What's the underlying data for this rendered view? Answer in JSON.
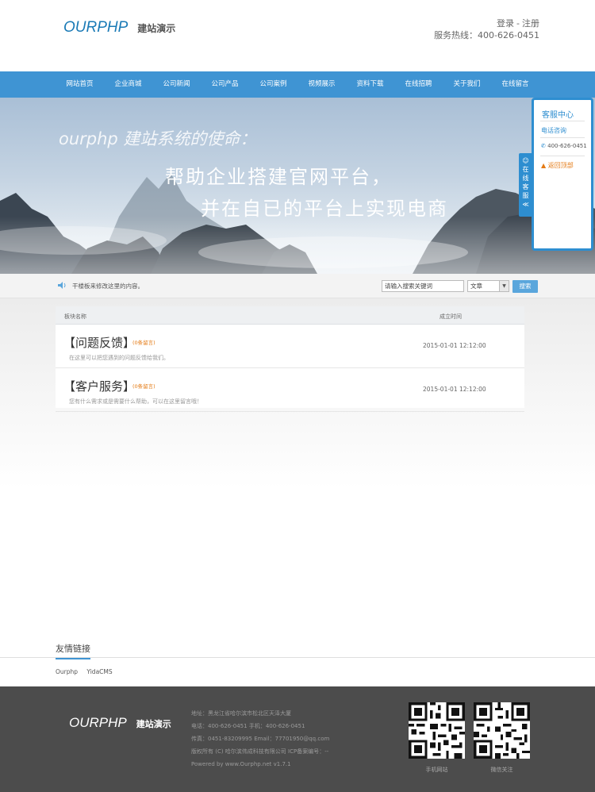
{
  "header": {
    "logo_main": "OURPHP",
    "logo_sub": "建站演示",
    "login": "登录",
    "separator": "-",
    "register": "注册",
    "hotline": "服务热线：400-626-0451"
  },
  "nav": {
    "items": [
      "网站首页",
      "企业商城",
      "公司新闻",
      "公司产品",
      "公司案例",
      "视频展示",
      "资料下载",
      "在线招聘",
      "关于我们",
      "在线留言"
    ]
  },
  "banner": {
    "title": "ourphp 建站系统的使命：",
    "line1": "帮助企业搭建官网平台，",
    "line2": "并在自已的平台上实现电商"
  },
  "service": {
    "tab_text": [
      "在",
      "线",
      "客",
      "服",
      "≪"
    ],
    "title": "客服中心",
    "call": "电话咨询",
    "phone": "400-626-0451",
    "back_to_top": "返回顶部"
  },
  "notice": {
    "text": "干楼板来修改这里的内容。"
  },
  "search": {
    "placeholder": "请输入搜索关键词",
    "select_value": "文章",
    "button": "搜索"
  },
  "board": {
    "header_name": "板块名称",
    "header_time": "成立时间",
    "rows": [
      {
        "name": "【问题反馈】",
        "count": "(0条留言)",
        "desc": "在这里可以把您遇到的问题反馈给我们。",
        "time": "2015-01-01 12:12:00"
      },
      {
        "name": "【客户服务】",
        "count": "(0条留言)",
        "desc": "您有什么需求或是需要什么帮助，可以在这里留言哦！",
        "time": "2015-01-01 12:12:00"
      }
    ]
  },
  "friend_links": {
    "title": "友情链接",
    "items": [
      "Ourphp",
      "YidaCMS"
    ]
  },
  "footer": {
    "logo_main": "OURPHP",
    "logo_sub": "建站演示",
    "info": [
      "地址：黑龙江省哈尔滨市松北区天泽大厦",
      "电话：400-626-0451  手机：400-626-0451",
      "传真：0451-83209995  Email：77701950@qq.com",
      "版权所有 (C) 哈尔滨伟成科技有限公司  ICP备案编号：--",
      "Powered by www.Ourphp.net v1.7.1"
    ],
    "qr1_label": "手机网站",
    "qr2_label": "微信关注"
  },
  "colors": {
    "nav": "#3f94d3",
    "accent": "#1a7ab6",
    "orange": "#e47a14",
    "footer": "#4c4c4c"
  }
}
